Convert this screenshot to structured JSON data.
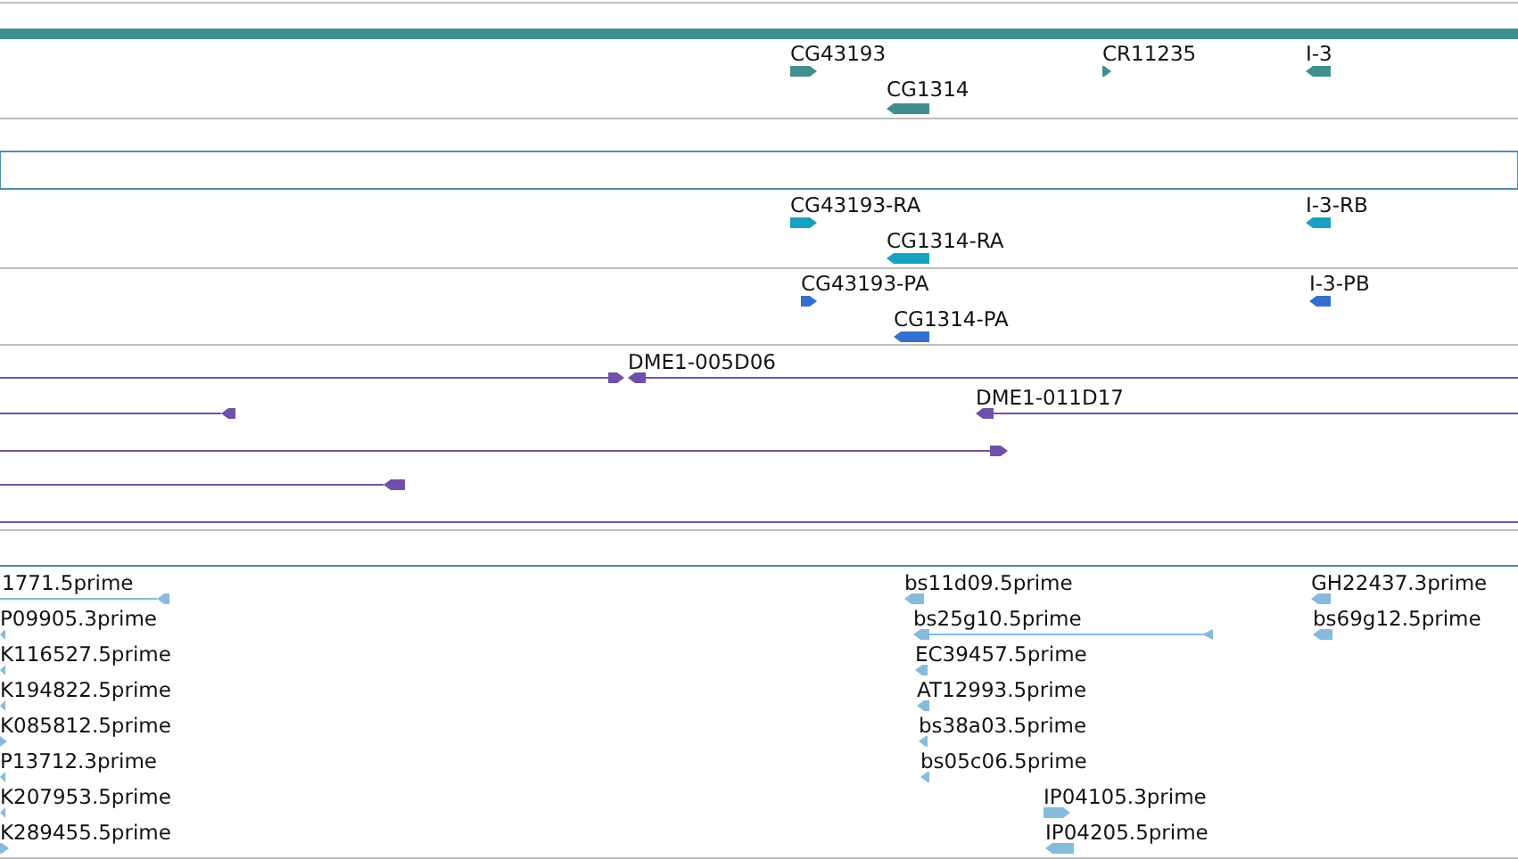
{
  "tracks": [
    {
      "kind": "gene",
      "color": "#3f8f8f",
      "features": [
        {
          "label": "CG43193",
          "reverse": false
        },
        {
          "label": "CR11235",
          "reverse": false
        },
        {
          "label": "I-3",
          "reverse": true
        },
        {
          "label": "CG1314",
          "reverse": true
        }
      ]
    },
    {
      "kind": "empty",
      "color": "#4a8fb0"
    },
    {
      "kind": "gene",
      "color": "#1aa0c0",
      "features": [
        {
          "label": "CG43193-RA",
          "reverse": false
        },
        {
          "label": "I-3-RB",
          "reverse": true
        },
        {
          "label": "CG1314-RA",
          "reverse": true
        }
      ]
    },
    {
      "kind": "gene",
      "color": "#3570d0",
      "features": [
        {
          "label": "CG43193-PA",
          "reverse": false
        },
        {
          "label": "I-3-PB",
          "reverse": true
        },
        {
          "label": "CG1314-PA",
          "reverse": true
        }
      ]
    },
    {
      "kind": "linked",
      "color": "#7050a8",
      "features": [
        {
          "kind": "glyph",
          "reverse": false
        },
        {
          "kind": "glyph",
          "label": "DME1-005D06",
          "reverse": true
        },
        {
          "kind": "glyph",
          "reverse": true
        },
        {
          "kind": "glyph",
          "label": "DME1-011D17",
          "reverse": true
        },
        {
          "kind": "glyph",
          "reverse": false
        },
        {
          "kind": "glyph",
          "reverse": true
        },
        {
          "kind": "line"
        }
      ]
    },
    {
      "kind": "linked",
      "color": "#86bbdc",
      "features": [
        {
          "label": "1771.5prime",
          "reverse": true
        },
        {
          "label": "bs11d09.5prime",
          "reverse": true
        },
        {
          "label": "GH22437.3prime",
          "reverse": true
        },
        {
          "label": "P09905.3prime",
          "reverse": true
        },
        {
          "label": "bs25g10.5prime",
          "reverse": true
        },
        {
          "label": "bs69g12.5prime",
          "reverse": true
        },
        {
          "label": "K116527.5prime",
          "reverse": true
        },
        {
          "label": "EC39457.5prime",
          "reverse": true
        },
        {
          "label": "K194822.5prime",
          "reverse": true
        },
        {
          "label": "AT12993.5prime",
          "reverse": true
        },
        {
          "label": "K085812.5prime",
          "reverse": false
        },
        {
          "label": "bs38a03.5prime",
          "reverse": true
        },
        {
          "label": "P13712.3prime",
          "reverse": true
        },
        {
          "label": "bs05c06.5prime",
          "reverse": true
        },
        {
          "label": "K207953.5prime",
          "reverse": true
        },
        {
          "label": "IP04105.3prime",
          "reverse": false
        },
        {
          "label": "K289455.5prime",
          "reverse": false
        },
        {
          "label": "IP04205.5prime",
          "reverse": true
        }
      ]
    }
  ]
}
